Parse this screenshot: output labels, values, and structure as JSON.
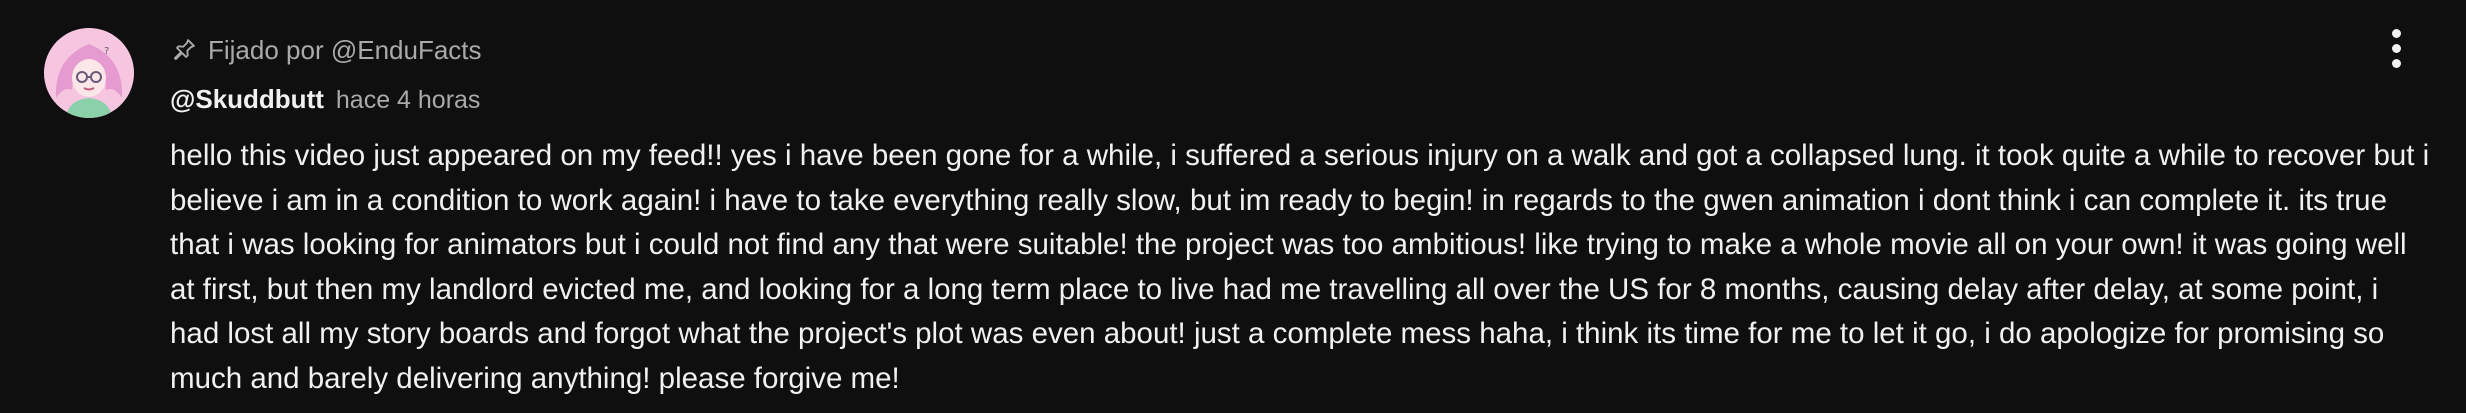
{
  "comment": {
    "pinned_label": "Fijado por @EnduFacts",
    "author": "@Skuddbutt",
    "timestamp": "hace 4 horas",
    "text": "hello this video just appeared on my feed!! yes i have been gone for a while, i suffered a serious injury on a walk and got a collapsed lung. it took quite a while to recover but i believe i am in a condition to work again! i have to take everything really slow, but im ready to begin! in regards to the gwen animation i dont think i can complete it. its true that i was looking for animators but i could not find any that were suitable! the project was too ambitious! like trying to make a whole movie all on your own! it was going well at first, but then my landlord evicted me, and looking for a long term place to live had me travelling all over the US for 8 months, causing delay after delay, at some point, i had lost all my story boards and forgot what the project's plot was even about! just a complete mess haha, i think its time for me to let it go, i do apologize for promising so much and barely delivering anything! please forgive me!"
  },
  "icons": {
    "pin": "pin-icon",
    "menu": "more-vert-icon"
  },
  "colors": {
    "background": "#0f0f0f",
    "text_primary": "#f1f1f1",
    "text_secondary": "#aaaaaa"
  }
}
